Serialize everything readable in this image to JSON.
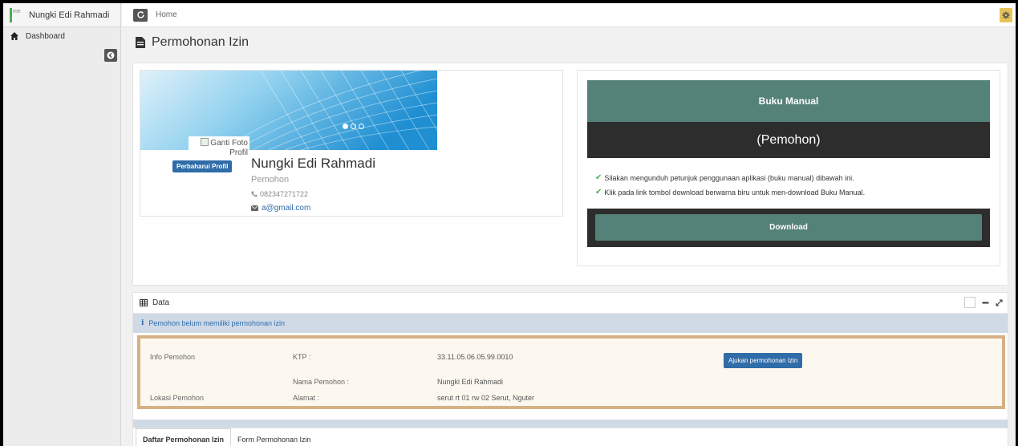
{
  "sidebar": {
    "avatar_alt": "me",
    "user_name": "Nungki Edi Rahmadi",
    "items": [
      {
        "label": "Dashboard",
        "icon": "home-icon"
      }
    ]
  },
  "topbar": {
    "breadcrumb": "Home"
  },
  "page": {
    "title": "Permohonan Izin"
  },
  "profile": {
    "photo_alt": "Ganti Foto Profil",
    "update_button": "Perbaharui Profil",
    "name": "Nungki Edi Rahmadi",
    "role": "Pemohon",
    "phone": "082347271722",
    "email": "a@gmail.com"
  },
  "manual": {
    "title": "Buku Manual",
    "subtitle": "(Pemohon)",
    "items": [
      "Silakan mengunduh petunjuk penggunaan aplikasi (buku manual) dibawah ini.",
      "Klik pada link tombol download berwarna biru untuk men-download Buku Manual."
    ],
    "download_label": "Download"
  },
  "data_panel": {
    "title": "Data",
    "info_message": "Pemohon belum memiliki permohonan izin",
    "info_pemohon_label": "Info Pemohon",
    "lokasi_pemohon_label": "Lokasi Pemohon",
    "ktp_label": "KTP :",
    "ktp_value": "33.11.05.06.05.99.0010",
    "nama_label": "Nama Pemohon :",
    "nama_value": "Nungki Edi Rahmadi",
    "alamat_label": "Alamat :",
    "alamat_value": "serut rt 01 rw 02 Serut, Nguter",
    "submit_button": "Ajukan permohonan Izin",
    "tabs": [
      {
        "label": "Daftar Permohonan Izin",
        "active": true
      },
      {
        "label": "Form Permohonan Izin",
        "active": false
      }
    ]
  },
  "colors": {
    "accent": "#2f6ca8",
    "manual_green": "#548178",
    "warning_border": "#d5b184"
  }
}
